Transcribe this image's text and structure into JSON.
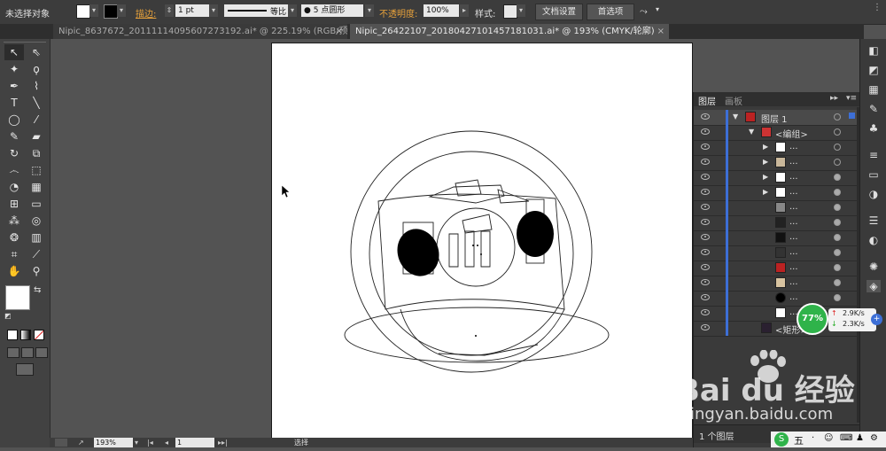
{
  "control_bar": {
    "selection_label": "未选择对象",
    "stroke_label": "描边:",
    "stroke_weight": "1 pt",
    "profile_label": "等比",
    "brush_label": "5 点圆形",
    "opacity_label": "不透明度:",
    "opacity_value": "100%",
    "style_label": "样式:",
    "doc_setup_button": "文档设置",
    "prefs_button": "首选项"
  },
  "tabs": [
    {
      "label": "Nipic_8637672_20111114095607273192.ai* @ 225.19% (RGB/预览)",
      "active": false
    },
    {
      "label": "Nipic_26422107_20180427101457181031.ai* @ 193% (CMYK/轮廓)",
      "active": true
    }
  ],
  "layers_panel": {
    "tab_layers": "图层",
    "tab_artboards": "画板",
    "rows": [
      {
        "name": "图层 1",
        "indent": 0
      },
      {
        "name": "<编组>",
        "indent": 1
      },
      {
        "name": "...",
        "indent": 2
      },
      {
        "name": "...",
        "indent": 2
      },
      {
        "name": "...",
        "indent": 2
      },
      {
        "name": "...",
        "indent": 2
      },
      {
        "name": "...",
        "indent": 3
      },
      {
        "name": "...",
        "indent": 3
      },
      {
        "name": "...",
        "indent": 3
      },
      {
        "name": "...",
        "indent": 3
      },
      {
        "name": "...",
        "indent": 3
      },
      {
        "name": "...",
        "indent": 3
      },
      {
        "name": "...",
        "indent": 3
      },
      {
        "name": "...",
        "indent": 3
      },
      {
        "name": "<矩形>",
        "indent": 1
      }
    ],
    "footer_label": "1 个图层"
  },
  "status_bar": {
    "zoom": "193%",
    "page": "1",
    "tool_label": "选择"
  },
  "speed_widget": {
    "percent": "77%",
    "up": "2.9K/s",
    "down": "2.3K/s"
  },
  "watermark": {
    "brand": "Bai du 经验",
    "url": "jingyan.baidu.com"
  },
  "colors": {
    "accent_orange": "#e8a23b",
    "layer_blue": "#3d6fd6",
    "speed_green": "#2fb34a"
  }
}
